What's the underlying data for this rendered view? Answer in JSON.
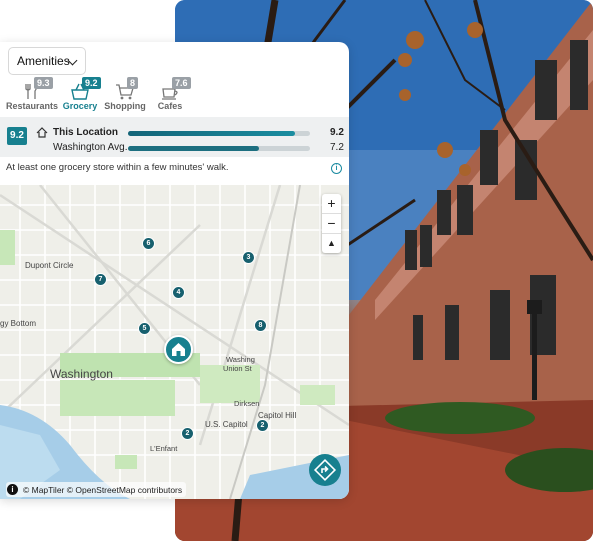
{
  "amenities_select": {
    "label": "Amenities"
  },
  "categories": [
    {
      "label": "Restaurants",
      "score": "9.3",
      "icon": "utensils-icon"
    },
    {
      "label": "Grocery",
      "score": "9.2",
      "icon": "basket-icon"
    },
    {
      "label": "Shopping",
      "score": "8",
      "icon": "cart-icon"
    },
    {
      "label": "Cafes",
      "score": "7.6",
      "icon": "coffee-cup-icon"
    }
  ],
  "score_panel": {
    "score": "9.2",
    "this_location": {
      "label": "This Location",
      "value": "9.2",
      "fraction": 0.92
    },
    "city_avg": {
      "label": "Washington Avg.",
      "value": "7.2",
      "fraction": 0.72
    }
  },
  "description": "At least one grocery store within a few minutes' walk.",
  "map": {
    "labels": {
      "dupont": "Dupont Circle",
      "foggy": "gy Bottom",
      "washington": "Washington",
      "union1": "Washing",
      "union2": "Union St",
      "dirksen": "Dirksen",
      "capitol": "U.S. Capitol",
      "capitol_hill": "Capitol Hill",
      "lenfant": "L'Enfant"
    },
    "markers": [
      "6",
      "3",
      "7",
      "4",
      "5",
      "8",
      "2",
      "2"
    ],
    "zoom_in": "+",
    "zoom_out": "−",
    "compass": "▲",
    "attribution": "© MapTiler © OpenStreetMap contributors",
    "attribution_icon": "i"
  },
  "colors": {
    "accent": "#17808f",
    "bar_city": "#1d6f80"
  }
}
